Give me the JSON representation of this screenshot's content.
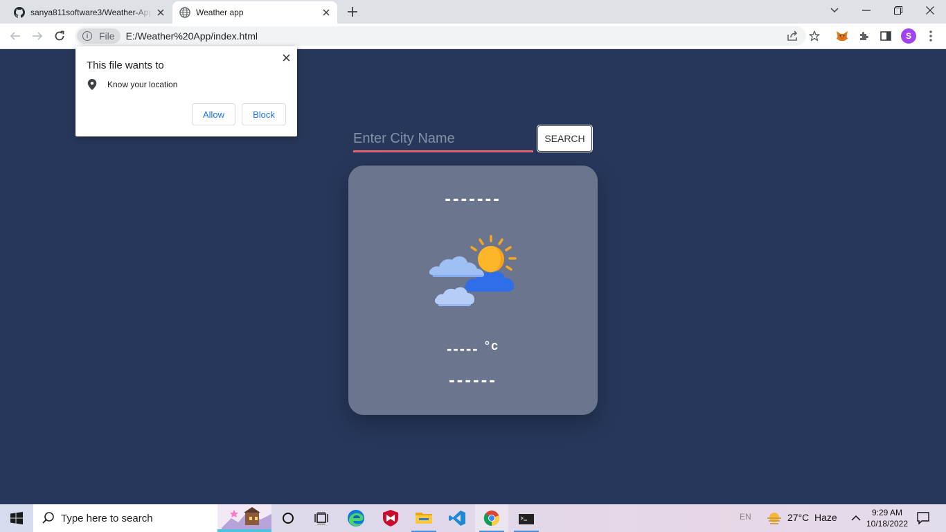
{
  "browser": {
    "tabs": [
      {
        "title": "sanya811software3/Weather-App",
        "active": false,
        "icon": "github-icon"
      },
      {
        "title": "Weather app",
        "active": true,
        "icon": "globe-icon"
      }
    ],
    "address": {
      "chip_label": "File",
      "url": "E:/Weather%20App/index.html"
    },
    "profile_initial": "S"
  },
  "permission_popup": {
    "title": "This file wants to",
    "permission": "Know your location",
    "allow_label": "Allow",
    "block_label": "Block"
  },
  "app": {
    "search_placeholder": "Enter City Name",
    "search_value": "",
    "search_button": "SEARCH",
    "city": "-------",
    "temp_value": "-----",
    "temp_unit": "°c",
    "condition": "------",
    "weather_icon": "partly-cloudy-icon"
  },
  "taskbar": {
    "search_placeholder": "Type here to search",
    "language": "EN",
    "weather_temp": "27°C",
    "weather_cond": "Haze",
    "time": "9:29 AM",
    "date": "10/18/2022"
  },
  "colors": {
    "page_bg": "#27375a",
    "card_bg": "#6b768e",
    "input_underline": "#e3656f",
    "link_blue": "#1a73e8"
  }
}
